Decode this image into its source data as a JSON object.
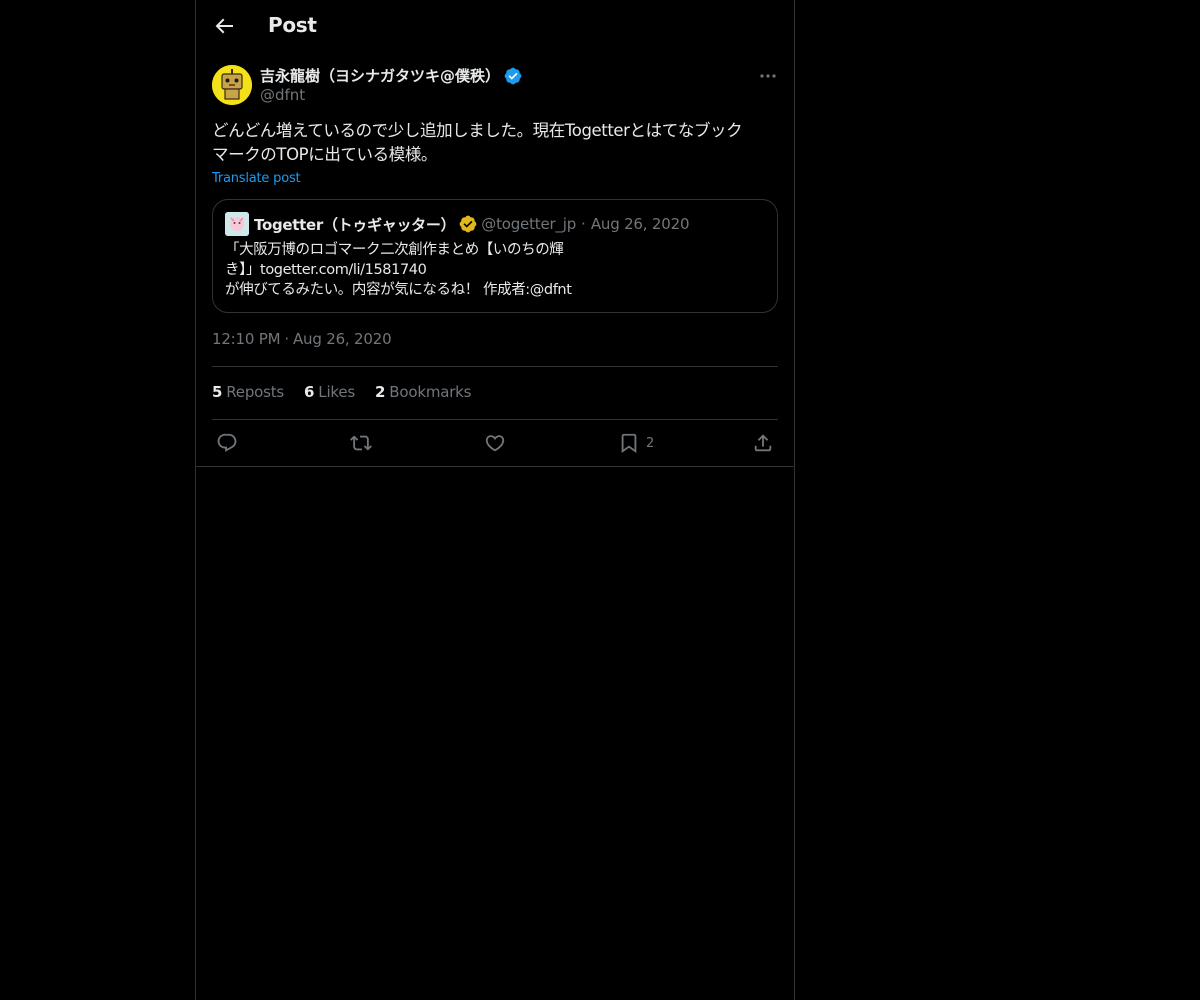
{
  "header": {
    "title": "Post"
  },
  "post": {
    "author_name": "吉永龍樹（ヨシナガタツキ@僕秩）",
    "author_handle": "@dfnt",
    "text": "どんどん増えているので少し追加しました。現在Togetterとはてなブック\nマークのTOPに出ている模様。",
    "translate_label": "Translate post",
    "time": "12:10 PM",
    "date": "Aug 26, 2020"
  },
  "quote": {
    "name": "Togetter（トゥギャッター）",
    "handle": "@togetter_jp",
    "dot": "·",
    "date": "Aug 26, 2020",
    "text": "「大阪万博のロゴマーク二次創作まとめ【いのちの輝\nき】」togetter.com/li/1581740\nが伸びてるみたい。内容が気になるね！ 作成者:@dfnt"
  },
  "stats": {
    "reposts_count": "5",
    "reposts_label": "Reposts",
    "likes_count": "6",
    "likes_label": "Likes",
    "bookmarks_count": "2",
    "bookmarks_label": "Bookmarks"
  },
  "actions": {
    "bookmark_count": "2"
  },
  "colors": {
    "background": "#000000",
    "accent": "#1d9bf0",
    "muted": "#71767b",
    "verified_blue": "#1d9bf0",
    "verified_gold": "#e2b719",
    "border": "#2f3336"
  },
  "icons": [
    "back-arrow-icon",
    "verified-badge-icon",
    "more-icon",
    "reply-icon",
    "repost-icon",
    "like-icon",
    "bookmark-icon",
    "share-icon"
  ]
}
